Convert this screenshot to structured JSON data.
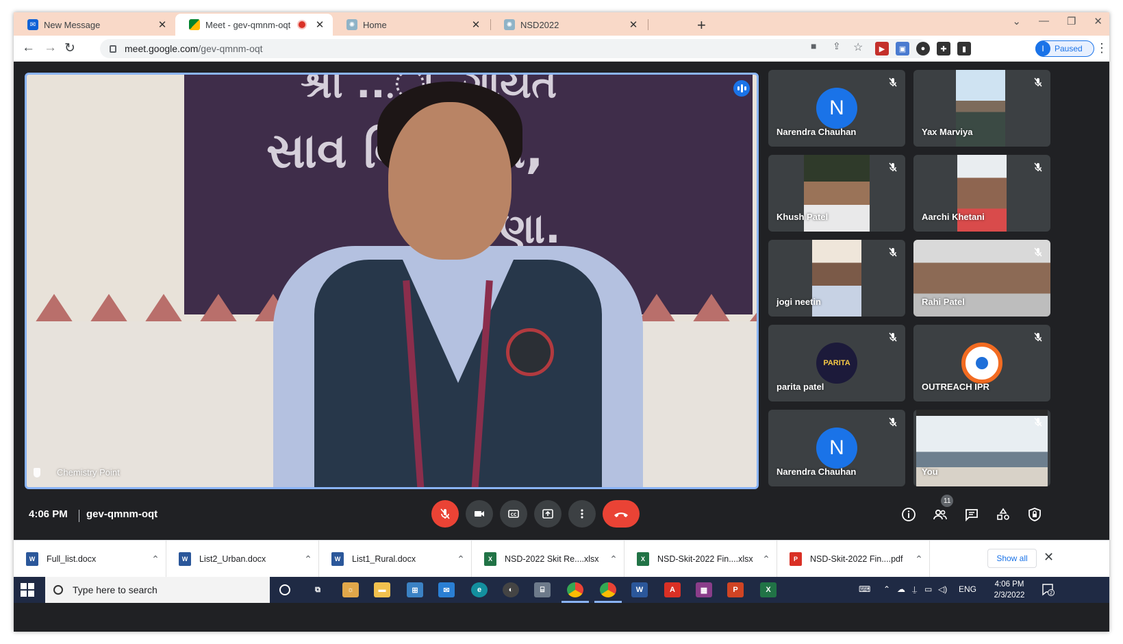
{
  "browser": {
    "tabs": [
      {
        "title": "New Message",
        "active": false
      },
      {
        "title": "Meet - gev-qmnm-oqt",
        "active": true,
        "recording": true
      },
      {
        "title": "Home",
        "active": false
      },
      {
        "title": "NSD2022",
        "active": false
      }
    ],
    "url_host": "meet.google.com",
    "url_path": "/gev-qmnm-oqt",
    "profile_initial": "I",
    "profile_status": "Paused"
  },
  "meet": {
    "main_participant": "Chemistry Point",
    "banner_line1": "શ્રી ...ા. ગાયત",
    "banner_line2": "સાવ     વિદ્યાલય,",
    "banner_line3": "ણા.",
    "participants": [
      {
        "name": "Narendra Chauhan",
        "initial": "N",
        "type": "avatar",
        "color": "#1a73e8"
      },
      {
        "name": "Yax Marviya",
        "type": "video"
      },
      {
        "name": "Khush Patel",
        "type": "video"
      },
      {
        "name": "Aarchi Khetani",
        "type": "video"
      },
      {
        "name": "jogi neetin",
        "type": "video"
      },
      {
        "name": "Rahi Patel",
        "type": "video"
      },
      {
        "name": "parita patel",
        "initial": "PARITA",
        "type": "avatar"
      },
      {
        "name": "OUTREACH IPR",
        "type": "avatar"
      },
      {
        "name": "Narendra Chauhan",
        "initial": "N",
        "type": "avatar",
        "color": "#1a73e8"
      },
      {
        "name": "You",
        "type": "video"
      }
    ],
    "time": "4:06 PM",
    "code": "gev-qmnm-oqt",
    "people_count": "11"
  },
  "downloads": {
    "items": [
      {
        "name": "Full_list.docx",
        "kind": "word"
      },
      {
        "name": "List2_Urban.docx",
        "kind": "word"
      },
      {
        "name": "List1_Rural.docx",
        "kind": "word"
      },
      {
        "name": "NSD-2022 Skit Re....xlsx",
        "kind": "excel"
      },
      {
        "name": "NSD-Skit-2022 Fin....xlsx",
        "kind": "excel"
      },
      {
        "name": "NSD-Skit-2022 Fin....pdf",
        "kind": "pdf"
      }
    ],
    "show_all": "Show all"
  },
  "taskbar": {
    "search_placeholder": "Type here to search",
    "lang": "ENG",
    "time": "4:06 PM",
    "date": "2/3/2022",
    "notifications": "2"
  },
  "colors": {
    "meet_bg": "#202124",
    "tile_bg": "#3c4043",
    "end_call": "#ea4335",
    "accent": "#1a73e8",
    "tab_strip": "#f9d9c8"
  }
}
